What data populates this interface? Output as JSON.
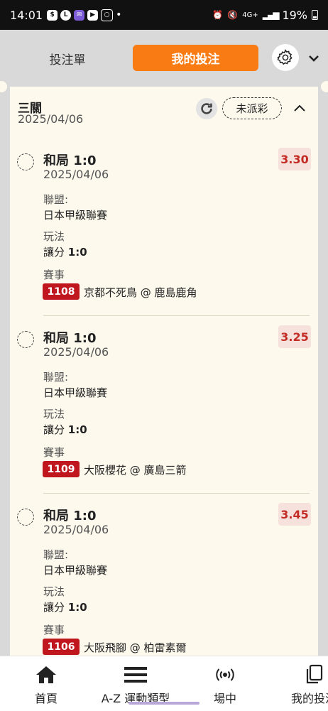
{
  "status_bar": {
    "time": "14:01",
    "app_icons": [
      "shopping-bag-icon",
      "line-icon",
      "message-icon",
      "youtube-icon",
      "instagram-icon"
    ],
    "battery": "19%",
    "network": "4G+"
  },
  "tabs": {
    "bet_slip": "投注單",
    "my_bets": "我的投注"
  },
  "combo": {
    "title": "三關",
    "date": "2025/04/06",
    "status": "未派彩"
  },
  "bets": [
    {
      "selection": "和局 1:0",
      "date": "2025/04/06",
      "odds": "3.30",
      "league_label": "聯盟:",
      "league": "日本甲級聯賽",
      "market_label": "玩法",
      "market_prefix": "讓分",
      "market_value": "1:0",
      "event_label": "賽事",
      "event_no": "1108",
      "event_name": "京都不死鳥 @ 鹿島鹿角"
    },
    {
      "selection": "和局 1:0",
      "date": "2025/04/06",
      "odds": "3.25",
      "league_label": "聯盟:",
      "league": "日本甲級聯賽",
      "market_label": "玩法",
      "market_prefix": "讓分",
      "market_value": "1:0",
      "event_label": "賽事",
      "event_no": "1109",
      "event_name": "大阪櫻花 @ 廣島三箭"
    },
    {
      "selection": "和局 1:0",
      "date": "2025/04/06",
      "odds": "3.45",
      "league_label": "聯盟:",
      "league": "日本甲級聯賽",
      "market_label": "玩法",
      "market_prefix": "讓分",
      "market_value": "1:0",
      "event_label": "賽事",
      "event_no": "1106",
      "event_name": "大阪飛腳 @ 柏雷素爾"
    }
  ],
  "nav": {
    "home": "首頁",
    "sports": "A-Z 運動類型",
    "live": "場中",
    "my_bets": "我的投注"
  },
  "colors": {
    "accent": "#f87b14",
    "panel": "#fdf9ed",
    "odds_bg": "#f6e1dd",
    "odds_text": "#c32b25",
    "event_badge": "#c0171e"
  }
}
